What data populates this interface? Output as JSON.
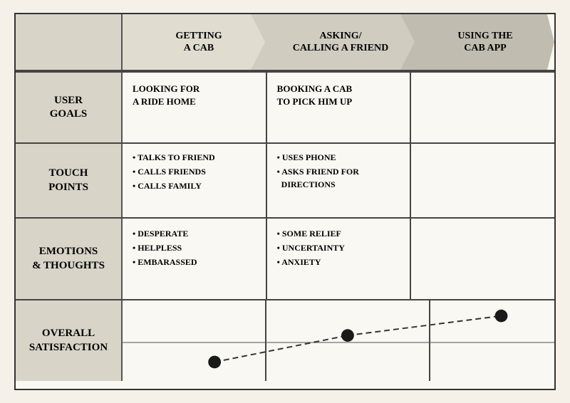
{
  "header": {
    "label_cell": "",
    "arrows": [
      {
        "id": "getting-a-cab",
        "line1": "Getting",
        "line2": "a Cab"
      },
      {
        "id": "asking-friend",
        "line1": "Asking/",
        "line2": "Calling a Friend"
      },
      {
        "id": "using-app",
        "line1": "Using the",
        "line2": "Cab App"
      }
    ]
  },
  "rows": [
    {
      "id": "user-goals",
      "label": "User\nGoals",
      "cells": [
        {
          "text": "Looking for\na ride home",
          "bullets": false
        },
        {
          "text": "Booking a Cab\nto Pick him up",
          "bullets": false
        },
        {
          "text": "",
          "bullets": false
        }
      ]
    },
    {
      "id": "touch-points",
      "label": "Touch\nPoints",
      "cells": [
        {
          "bullets": true,
          "items": [
            "Talks to Friend",
            "Calls Friends",
            "Calls Family"
          ]
        },
        {
          "bullets": true,
          "items": [
            "Uses Phone",
            "Asks Friend for\nDirections"
          ]
        },
        {
          "bullets": false,
          "text": ""
        }
      ]
    },
    {
      "id": "emotions",
      "label": "Emotions\n& Thoughts",
      "cells": [
        {
          "bullets": true,
          "items": [
            "Desperate",
            "Helpless",
            "Embarassed"
          ]
        },
        {
          "bullets": true,
          "items": [
            "Some Relief",
            "Uncertainty",
            "Anxiety"
          ]
        },
        {
          "bullets": false,
          "text": ""
        }
      ]
    }
  ],
  "satisfaction": {
    "label": "Overall\nSatisfaction",
    "graph": {
      "points": [
        {
          "x": 0.22,
          "y": 0.75
        },
        {
          "x": 0.52,
          "y": 0.42
        },
        {
          "x": 0.88,
          "y": 0.18
        }
      ]
    }
  }
}
